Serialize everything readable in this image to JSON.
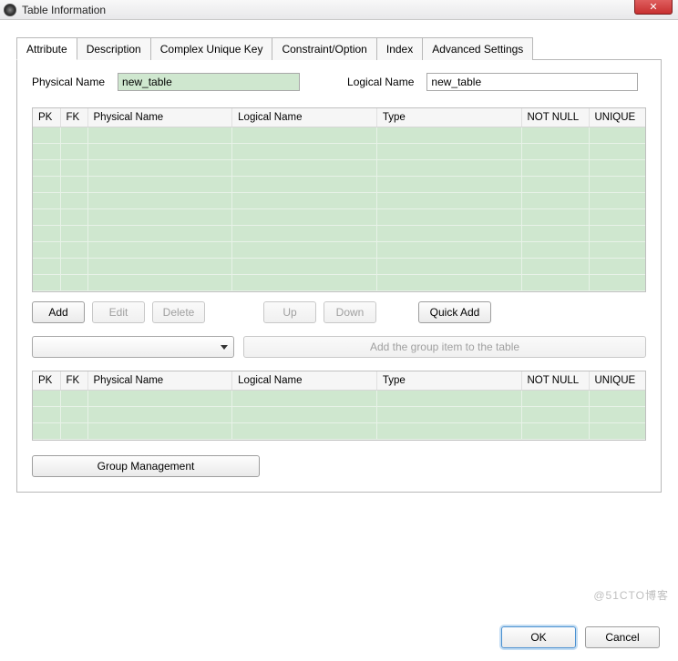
{
  "window": {
    "title": "Table Information",
    "close_label": "✕"
  },
  "tabs": [
    {
      "label": "Attribute",
      "active": true
    },
    {
      "label": "Description"
    },
    {
      "label": "Complex Unique Key"
    },
    {
      "label": "Constraint/Option"
    },
    {
      "label": "Index"
    },
    {
      "label": "Advanced Settings"
    }
  ],
  "fields": {
    "physical_name_label": "Physical Name",
    "physical_name_value": "new_table",
    "logical_name_label": "Logical Name",
    "logical_name_value": "new_table"
  },
  "columns": {
    "pk": "PK",
    "fk": "FK",
    "physical_name": "Physical Name",
    "logical_name": "Logical Name",
    "type": "Type",
    "not_null": "NOT NULL",
    "unique": "UNIQUE"
  },
  "buttons": {
    "add": "Add",
    "edit": "Edit",
    "delete": "Delete",
    "up": "Up",
    "down": "Down",
    "quick_add": "Quick Add",
    "add_group_item": "Add the group item to the table",
    "group_management": "Group Management",
    "ok": "OK",
    "cancel": "Cancel"
  },
  "watermark": "@51CTO博客"
}
